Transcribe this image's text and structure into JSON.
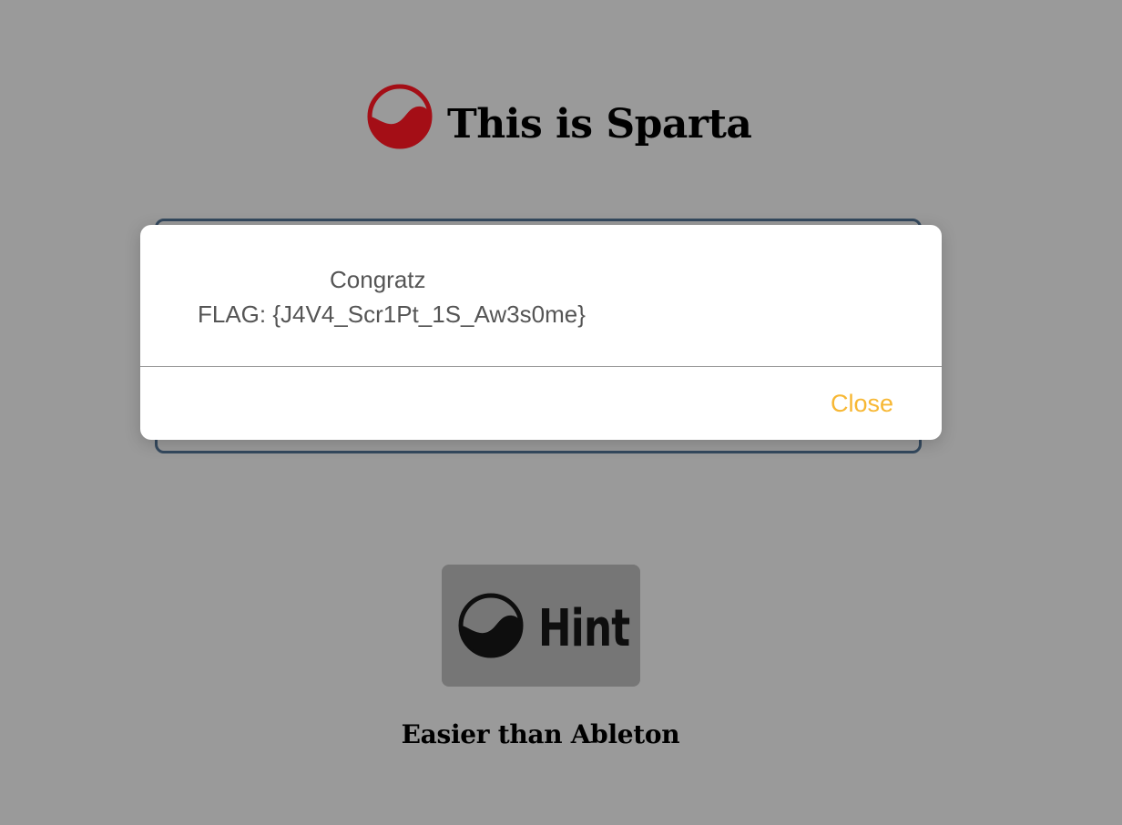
{
  "header": {
    "logo_icon": "yin-yang-logo-icon",
    "title": "This is Sparta",
    "logo_color": "#a40e16"
  },
  "modal": {
    "message_line1": "Congratz",
    "message_line2": "FLAG: {J4V4_Scr1Pt_1S_Aw3s0me}",
    "close_label": "Close",
    "close_color": "#f7b733"
  },
  "hint_button": {
    "icon": "yin-yang-logo-icon",
    "label": "Hint"
  },
  "footer": {
    "tagline": "Easier than Ableton"
  },
  "colors": {
    "overlay_background": "#9a9a9a",
    "panel_border": "#34495e",
    "hint_background": "#767676"
  }
}
